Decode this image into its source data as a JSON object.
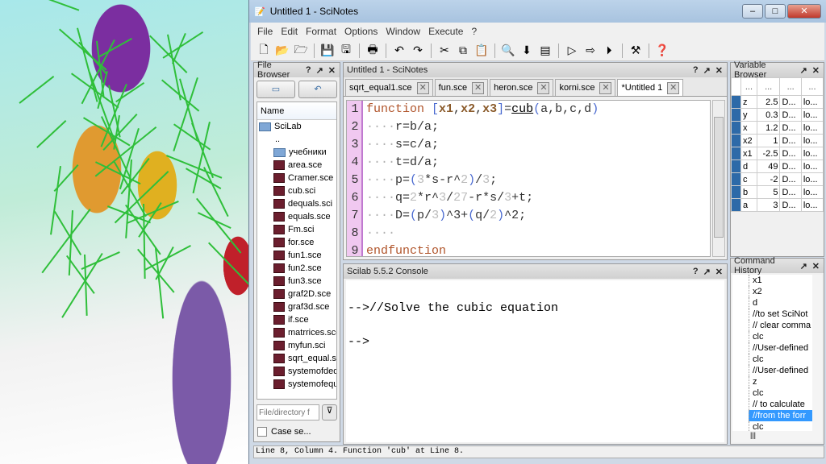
{
  "window": {
    "title": "Untitled 1 - SciNotes"
  },
  "menu": [
    "File",
    "Edit",
    "Format",
    "Options",
    "Window",
    "Execute",
    "?"
  ],
  "toolbar": [
    "new-icon",
    "open-icon",
    "open-file-icon",
    "save-icon",
    "save-as-icon",
    "print-icon",
    "undo-icon",
    "redo-icon",
    "cut-icon",
    "copy-icon",
    "paste-icon",
    "find-icon",
    "load-execute-icon",
    "variables-icon",
    "execute-icon",
    "execute-echo-icon",
    "execute-all-icon",
    "preferences-icon",
    "help-icon"
  ],
  "file_browser": {
    "title": "File Browser",
    "column": "Name",
    "root": "SciLab",
    "parent": "..",
    "folder": "учебники",
    "files": [
      "area.sce",
      "Cramer.sce",
      "cub.sci",
      "dequals.sci",
      "equals.sce",
      "Fm.sci",
      "for.sce",
      "fun1.sce",
      "fun2.sce",
      "fun3.sce",
      "graf2D.sce",
      "graf3d.sce",
      "if.sce",
      "matrrices.sce",
      "myfun.sci",
      "sqrt_equal.sce",
      "systemofdeq",
      "systemofequ"
    ],
    "filter_placeholder": "File/directory f",
    "case_label": "Case se..."
  },
  "editor": {
    "title": "Untitled 1 - SciNotes",
    "tabs": [
      "sqrt_equal1.sce",
      "fun.sce",
      "heron.sce",
      "korni.sce",
      "*Untitled 1"
    ],
    "lines": [
      [
        [
          "k",
          "function "
        ],
        [
          "p",
          "["
        ],
        [
          "v",
          "x1"
        ],
        [
          "o",
          ","
        ],
        [
          "v",
          "x2"
        ],
        [
          "o",
          ","
        ],
        [
          "v",
          "x3"
        ],
        [
          "p",
          "]"
        ],
        [
          "o",
          "="
        ],
        [
          "f",
          "cub"
        ],
        [
          "p",
          "("
        ],
        [
          "o",
          "a,b,c,d"
        ],
        [
          "p",
          ")"
        ]
      ],
      [
        [
          "d",
          "····"
        ],
        [
          "o",
          "r=b/a;"
        ]
      ],
      [
        [
          "d",
          "····"
        ],
        [
          "o",
          "s=c/a;"
        ]
      ],
      [
        [
          "d",
          "····"
        ],
        [
          "o",
          "t=d/a;"
        ]
      ],
      [
        [
          "d",
          "····"
        ],
        [
          "o",
          "p="
        ],
        [
          "p",
          "("
        ],
        [
          "nm",
          "3"
        ],
        [
          "o",
          "*s-r^"
        ],
        [
          "nm",
          "2"
        ],
        [
          "p",
          ")"
        ],
        [
          "o",
          "/"
        ],
        [
          "nm",
          "3"
        ],
        [
          "o",
          ";"
        ]
      ],
      [
        [
          "d",
          "····"
        ],
        [
          "o",
          "q="
        ],
        [
          "nm",
          "2"
        ],
        [
          "o",
          "*r^"
        ],
        [
          "nm",
          "3"
        ],
        [
          "o",
          "/"
        ],
        [
          "nm",
          "27"
        ],
        [
          "o",
          "-r*s/"
        ],
        [
          "nm",
          "3"
        ],
        [
          "o",
          "+t;"
        ]
      ],
      [
        [
          "d",
          "····"
        ],
        [
          "o",
          "D="
        ],
        [
          "p",
          "("
        ],
        [
          "o",
          "p/"
        ],
        [
          "nm",
          "3"
        ],
        [
          "p",
          ")"
        ],
        [
          "o",
          "^3+"
        ],
        [
          "p",
          "("
        ],
        [
          "o",
          "q/"
        ],
        [
          "nm",
          "2"
        ],
        [
          "p",
          ")"
        ],
        [
          "o",
          "^2;"
        ]
      ],
      [
        [
          "d",
          "····"
        ]
      ],
      [
        [
          "k",
          "endfunction"
        ]
      ]
    ]
  },
  "console": {
    "title": "Scilab 5.5.2 Console",
    "lines": [
      "-->//Solve the cubic equation",
      "-->"
    ]
  },
  "variables": {
    "title": "Variable Browser",
    "headers": [
      "...",
      "...",
      "...",
      "..."
    ],
    "rows": [
      [
        "z",
        "2.5",
        "D...",
        "lo..."
      ],
      [
        "y",
        "0.3",
        "D...",
        "lo..."
      ],
      [
        "x",
        "1.2",
        "D...",
        "lo..."
      ],
      [
        "x2",
        "1",
        "D...",
        "lo..."
      ],
      [
        "x1",
        "-2.5",
        "D...",
        "lo..."
      ],
      [
        "d",
        "49",
        "D...",
        "lo..."
      ],
      [
        "c",
        "-2",
        "D...",
        "lo..."
      ],
      [
        "b",
        "5",
        "D...",
        "lo..."
      ],
      [
        "a",
        "3",
        "D...",
        "lo..."
      ]
    ]
  },
  "history": {
    "title": "Command History",
    "items": [
      "x1",
      "x2",
      "d",
      "//to set SciNot",
      "// clear comma",
      "clc",
      "//User-defined",
      "clc",
      "//User-defined",
      "z",
      "clc",
      "// to calculate",
      "//from the forr",
      "clc"
    ],
    "selected": 12
  },
  "status": "Line 8, Column 4. Function 'cub' at Line 8."
}
